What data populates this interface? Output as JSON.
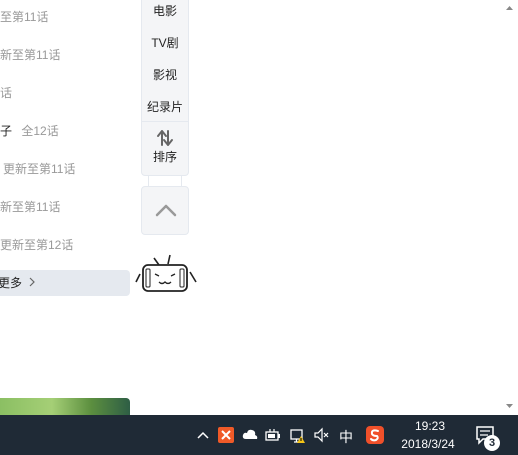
{
  "left_list": {
    "items": [
      {
        "text": "至第11话"
      },
      {
        "text": "新至第11话"
      },
      {
        "text": "话"
      },
      {
        "prefix": "子",
        "text": "全12话"
      },
      {
        "text": "更新至第11话"
      },
      {
        "text": "新至第11话"
      },
      {
        "text": "更新至第12话"
      },
      {
        "text": "更多"
      }
    ]
  },
  "category_panel": {
    "items": [
      "电影",
      "TV剧",
      "影视",
      "纪录片"
    ],
    "sort_label": "排序"
  },
  "taskbar": {
    "ime_label": "中",
    "time": "19:23",
    "date": "2018/3/24",
    "notification_count": "3"
  }
}
